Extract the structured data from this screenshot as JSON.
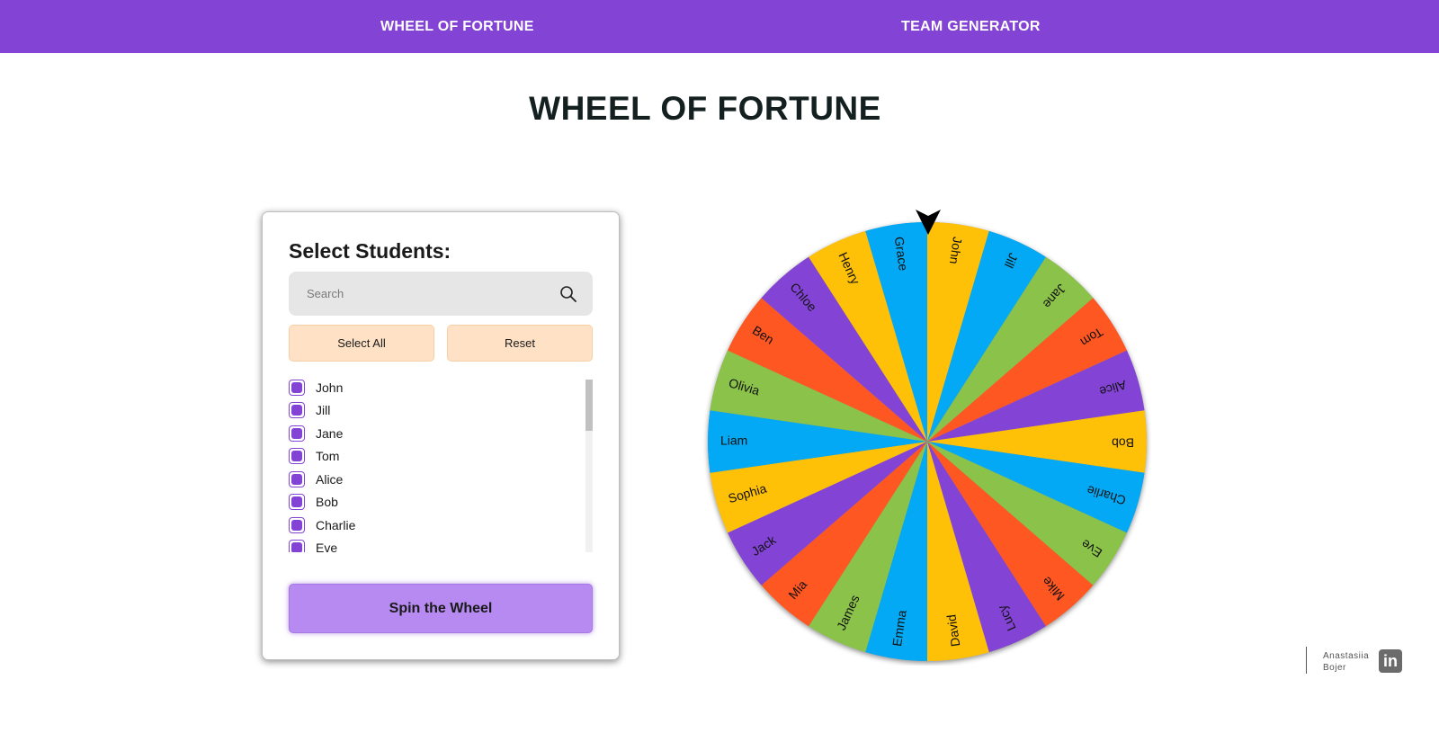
{
  "nav": {
    "wheel_label": "WHEEL OF FORTUNE",
    "team_label": "TEAM GENERATOR"
  },
  "page_title": "WHEEL OF FORTUNE",
  "panel": {
    "title": "Select Students:",
    "search_placeholder": "Search",
    "select_all_label": "Select All",
    "reset_label": "Reset",
    "spin_label": "Spin the Wheel",
    "students": [
      {
        "name": "John",
        "checked": true
      },
      {
        "name": "Jill",
        "checked": true
      },
      {
        "name": "Jane",
        "checked": true
      },
      {
        "name": "Tom",
        "checked": true
      },
      {
        "name": "Alice",
        "checked": true
      },
      {
        "name": "Bob",
        "checked": true
      },
      {
        "name": "Charlie",
        "checked": true
      },
      {
        "name": "Eve",
        "checked": true
      }
    ]
  },
  "wheel": {
    "names": [
      "John",
      "Jill",
      "Jane",
      "Tom",
      "Alice",
      "Bob",
      "Charlie",
      "Eve",
      "Mike",
      "Lucy",
      "David",
      "Emma",
      "James",
      "Mia",
      "Jack",
      "Sophia",
      "Liam",
      "Olivia",
      "Ben",
      "Chloe",
      "Henry",
      "Grace"
    ],
    "colors": [
      "#ffc107",
      "#03a9f4",
      "#8bc34a",
      "#ff5722",
      "#8344d6"
    ]
  },
  "credit": {
    "line1": "Anastasiia",
    "line2": "Bojer",
    "icon_name": "linkedin-icon",
    "icon_text": "in"
  },
  "colors": {
    "accent": "#8344d6",
    "button_bg": "#ffe2c6",
    "spin_bg": "#b68af1"
  }
}
